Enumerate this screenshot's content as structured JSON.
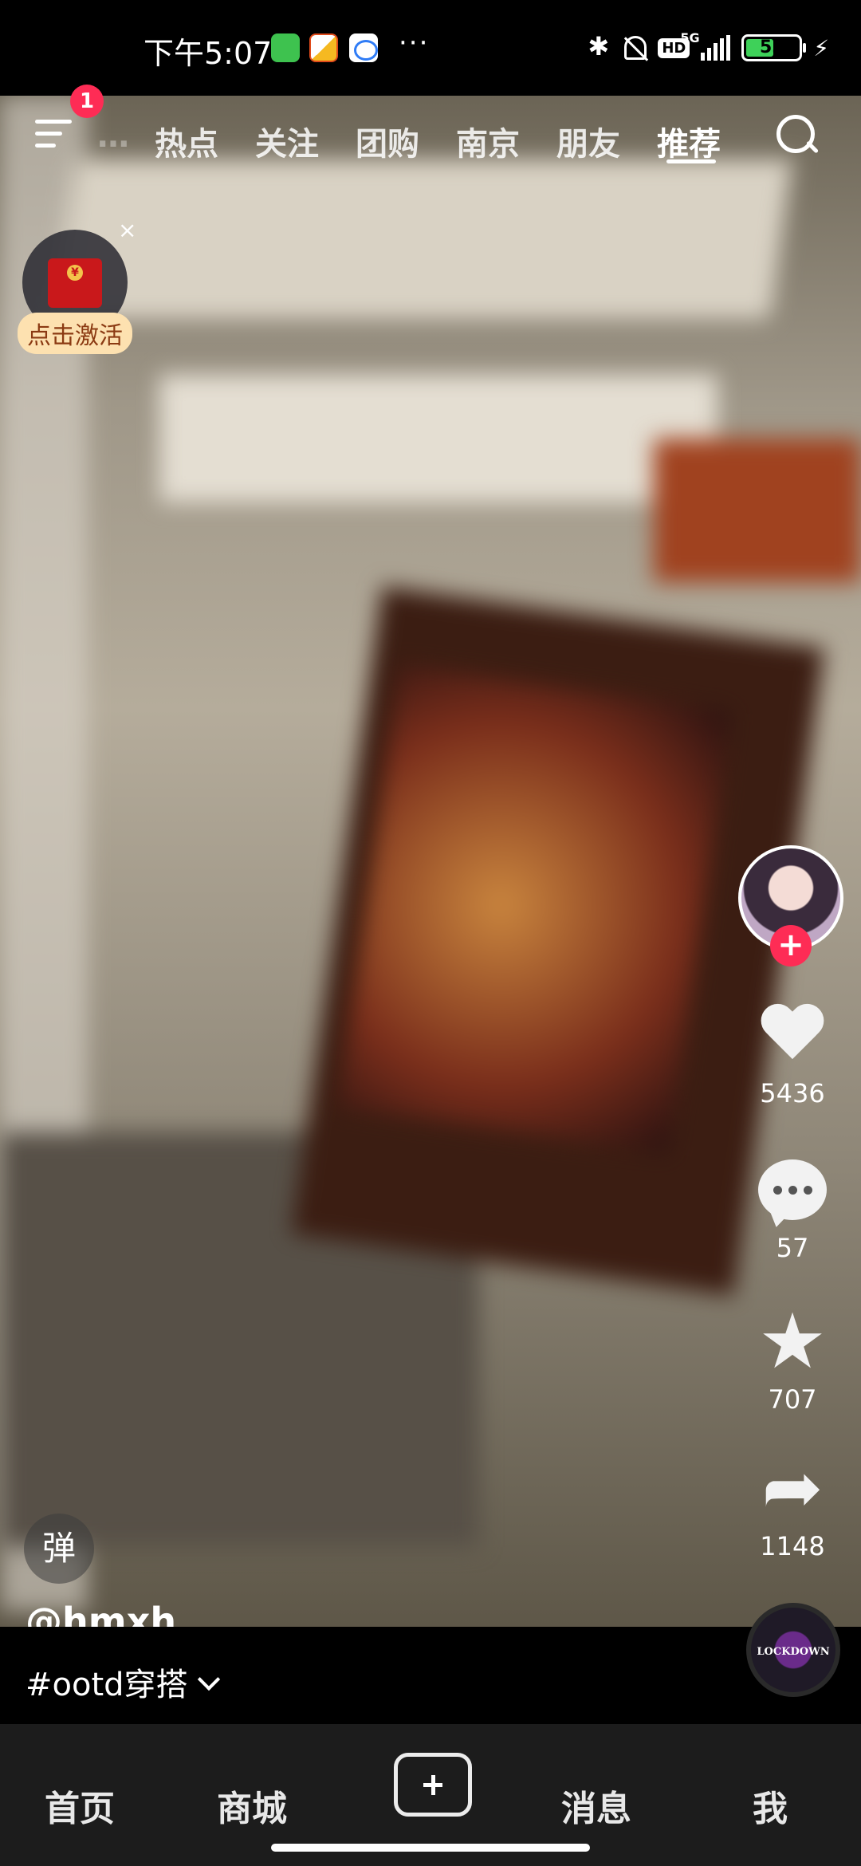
{
  "status_bar": {
    "time": "下午5:07",
    "more": "···",
    "hd": "HD",
    "network": "5G",
    "battery": "53",
    "battery_level": 0.53
  },
  "top_nav": {
    "menu_badge": "1",
    "tabs": [
      {
        "label": "热点"
      },
      {
        "label": "关注"
      },
      {
        "label": "团购"
      },
      {
        "label": "南京"
      },
      {
        "label": "朋友"
      },
      {
        "label": "推荐",
        "active": true
      }
    ]
  },
  "promo": {
    "label": "点击激活",
    "close": "×"
  },
  "actions": {
    "likes": "5436",
    "comments": "57",
    "favorites": "707",
    "shares": "1148"
  },
  "music_disc": {
    "label": "LOCKDOWN"
  },
  "video_info": {
    "danmu": "弹",
    "author": "@hmxh",
    "caption": "#ootd穿搭"
  },
  "tab_bar": {
    "home": "首页",
    "mall": "商城",
    "messages": "消息",
    "me": "我"
  }
}
